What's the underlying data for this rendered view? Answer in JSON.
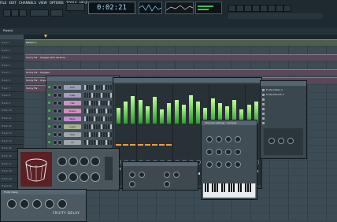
{
  "app": {
    "title": "FL Studio"
  },
  "menu": [
    "FILE",
    "EDIT",
    "CHANNELS",
    "VIEW",
    "OPTIONS",
    "TOOLS",
    "HELP"
  ],
  "transport": {
    "time": "0:02:21"
  },
  "hint_bar": {
    "text": ""
  },
  "playlist": {
    "title": "Playlist",
    "tracks": [
      "Track 1",
      "Track 2",
      "Track 3",
      "Track 4",
      "Track 5",
      "Track 6",
      "Track 7",
      "Track 8",
      "Track 9",
      "Track 10",
      "Track 11",
      "Track 12",
      "Track 13",
      "Track 14",
      "Track 15",
      "Track 16",
      "Track 17",
      "Track 18",
      "Track 19",
      "Track 20",
      "Track 21",
      "Track 22",
      "Track 23",
      "Track 24"
    ],
    "clips": [
      {
        "label": "Pattern 1",
        "track": 0
      },
      {
        "label": "Sonny Far - Voyager (full version)",
        "track": 2
      },
      {
        "label": "Sonny Far - Voyager",
        "track": 4
      },
      {
        "label": "Sonny Far - Voyager",
        "track": 5
      },
      {
        "label": "Sonny Far - Voyager",
        "track": 6
      }
    ]
  },
  "step_sequencer": {
    "channels": [
      {
        "name": "Kick",
        "color": "#9a9eb5"
      },
      {
        "name": "Clap",
        "color": "#a79cbf"
      },
      {
        "name": "Hat",
        "color": "#c995c5"
      },
      {
        "name": "Snare",
        "color": "#d08fbb"
      },
      {
        "name": "Bass",
        "color": "#c48ad0"
      },
      {
        "name": "Lead",
        "color": "#a7b38e"
      },
      {
        "name": "Pad",
        "color": "#9fa8ab"
      },
      {
        "name": "FX",
        "color": "#a1a7ad"
      }
    ]
  },
  "browser": {
    "items": [
      "Fruity Delay 2",
      "Fruity Reverb 2",
      "",
      "",
      "",
      "",
      "",
      ""
    ]
  },
  "delay_plugin": {
    "title": "Channel settings - Sampler"
  },
  "fruity_delay": {
    "title": "Fruity Delay",
    "logo": "FRUITY DELAY"
  },
  "colors": {
    "accent": "#e6a040",
    "meter_green": "#3fc04f"
  }
}
